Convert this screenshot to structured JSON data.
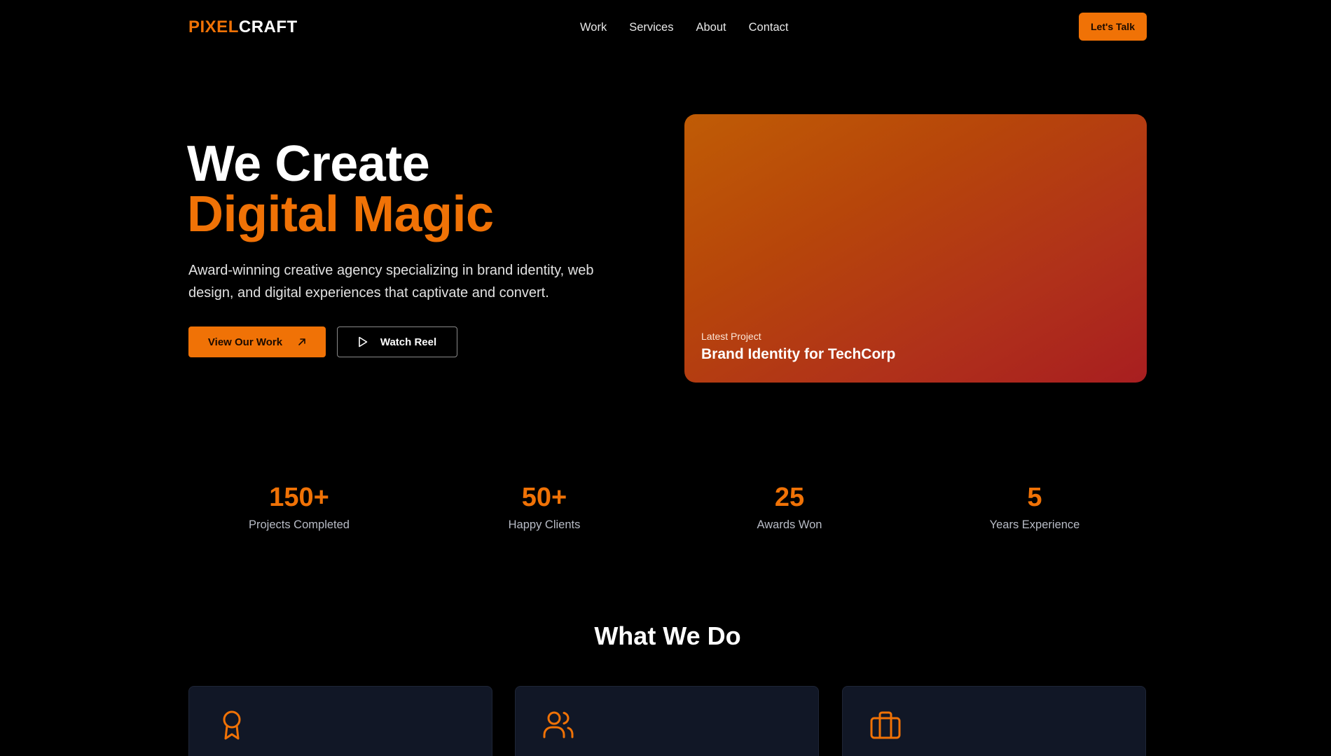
{
  "nav": {
    "logo_part1": "PIXEL",
    "logo_part2": "CRAFT",
    "links": [
      "Work",
      "Services",
      "About",
      "Contact"
    ],
    "cta_label": "Let's Talk"
  },
  "hero": {
    "title_line1": "We Create",
    "title_line2": "Digital Magic",
    "description": "Award-winning creative agency specializing in brand identity, web design, and digital experiences that captivate and convert.",
    "primary_button": "View Our Work",
    "primary_button_icon": "arrow-up-right-icon",
    "secondary_button": "Watch Reel",
    "secondary_button_icon": "play-icon",
    "card": {
      "label": "Latest Project",
      "title": "Brand Identity for TechCorp"
    }
  },
  "stats": [
    {
      "value": "150+",
      "label": "Projects Completed"
    },
    {
      "value": "50+",
      "label": "Happy Clients"
    },
    {
      "value": "25",
      "label": "Awards Won"
    },
    {
      "value": "5",
      "label": "Years Experience"
    }
  ],
  "services": {
    "title": "What We Do",
    "cards": [
      {
        "icon": "award-icon"
      },
      {
        "icon": "users-icon"
      },
      {
        "icon": "briefcase-icon"
      }
    ]
  },
  "colors": {
    "accent": "#f07206",
    "background": "#000000",
    "card_bg": "#111726",
    "muted_text": "#b8bcc6"
  }
}
